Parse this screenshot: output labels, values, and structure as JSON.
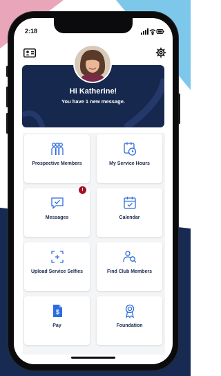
{
  "status_bar": {
    "time": "2:18"
  },
  "header": {
    "greeting": "Hi Katherine!",
    "message": "You have 1 new message."
  },
  "tiles": [
    {
      "label": "Prospective Members",
      "icon": "people-icon"
    },
    {
      "label": "My Service Hours",
      "icon": "stopwatch-icon"
    },
    {
      "label": "Messages",
      "icon": "message-check-icon",
      "badge": "!"
    },
    {
      "label": "Calendar",
      "icon": "calendar-icon"
    },
    {
      "label": "Upload Service Selfies",
      "icon": "photo-upload-icon"
    },
    {
      "label": "Find Club Members",
      "icon": "person-search-icon"
    },
    {
      "label": "Pay",
      "icon": "dollar-document-icon"
    },
    {
      "label": "Foundation",
      "icon": "award-ribbon-icon"
    }
  ],
  "colors": {
    "navy": "#17284f",
    "accent_blue": "#2d6cdf",
    "badge_red": "#a31527"
  }
}
